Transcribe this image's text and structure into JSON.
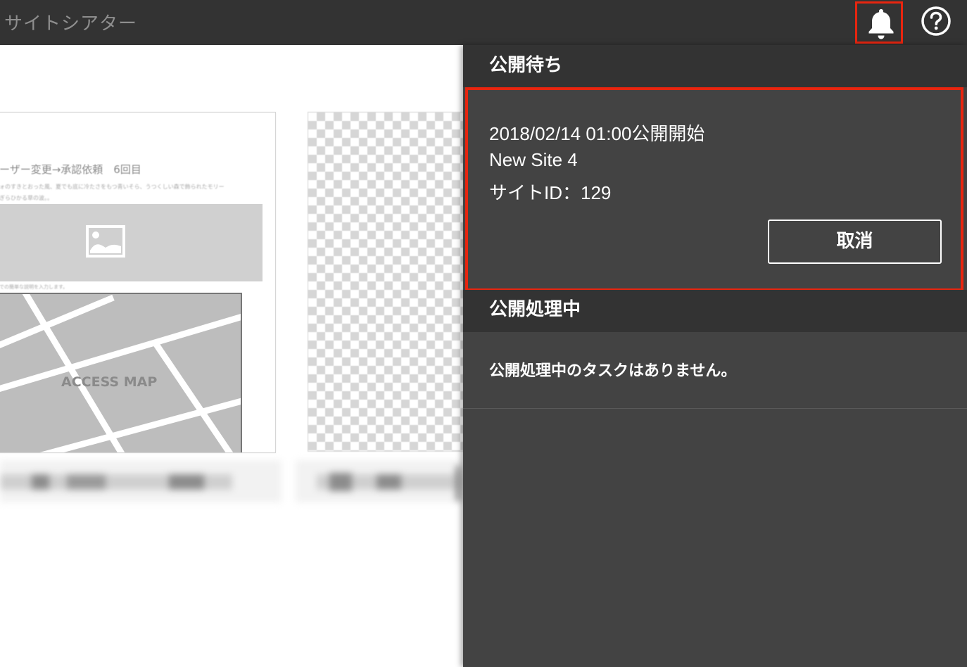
{
  "app": {
    "title": "サイトシアター"
  },
  "header": {
    "notification_icon": "bell-icon",
    "help_icon": "question-circle-icon",
    "highlight_color": "#e8250f"
  },
  "background": {
    "card1": {
      "title": "ーザー変更→承認依頼　6回目",
      "desc_line1": "ォのすきとおった風、夏でも底に冷たさをもつ青いそら、うつくしい森で飾られたモリー",
      "desc_line2": "ぎらひかる草の波。。",
      "caption": "での簡単な説明を入力します。",
      "map_label": "ACCESS MAP"
    }
  },
  "panel": {
    "pending": {
      "heading": "公開待ち",
      "task": {
        "schedule": "2018/02/14 01:00公開開始",
        "site_name": "New Site 4",
        "site_id": "サイトID：129",
        "cancel_label": "取消"
      }
    },
    "processing": {
      "heading": "公開処理中",
      "empty_message": "公開処理中のタスクはありません。"
    }
  }
}
